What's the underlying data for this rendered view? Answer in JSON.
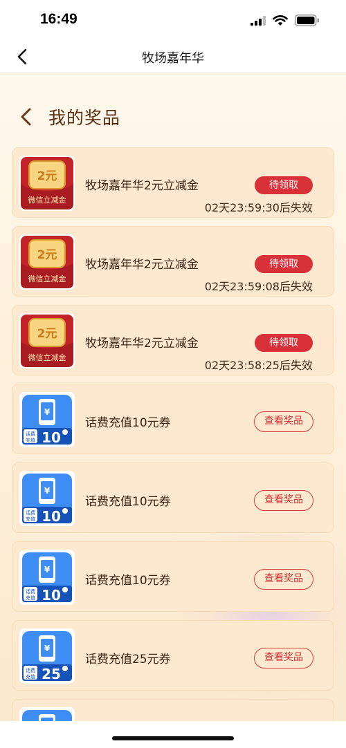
{
  "status_bar": {
    "time": "16:49"
  },
  "nav": {
    "title": "牧场嘉年华"
  },
  "section": {
    "title": "我的奖品"
  },
  "red_envelope_art": {
    "amount": "2元",
    "caption": "微信立减金"
  },
  "prizes": [
    {
      "title": "牧场嘉年华2元立减金",
      "action": "待领取",
      "expire": "02天23:59:30后失效"
    },
    {
      "title": "牧场嘉年华2元立减金",
      "action": "待领取",
      "expire": "02天23:59:08后失效"
    },
    {
      "title": "牧场嘉年华2元立减金",
      "action": "待领取",
      "expire": "02天23:58:25后失效"
    },
    {
      "title": "话费充值10元券",
      "action": "查看奖品",
      "amount": "10",
      "tag": "话费充值"
    },
    {
      "title": "话费充值10元券",
      "action": "查看奖品",
      "amount": "10",
      "tag": "话费充值"
    },
    {
      "title": "话费充值10元券",
      "action": "查看奖品",
      "amount": "10",
      "tag": "话费充值"
    },
    {
      "title": "话费充值25元券",
      "action": "查看奖品",
      "amount": "25",
      "tag": "话费充值"
    }
  ],
  "colors": {
    "primary_red": "#d8313a",
    "card_bg": "#fde9cf",
    "title_brown": "#5a2e12",
    "phone_blue": "#2f7ff3"
  }
}
